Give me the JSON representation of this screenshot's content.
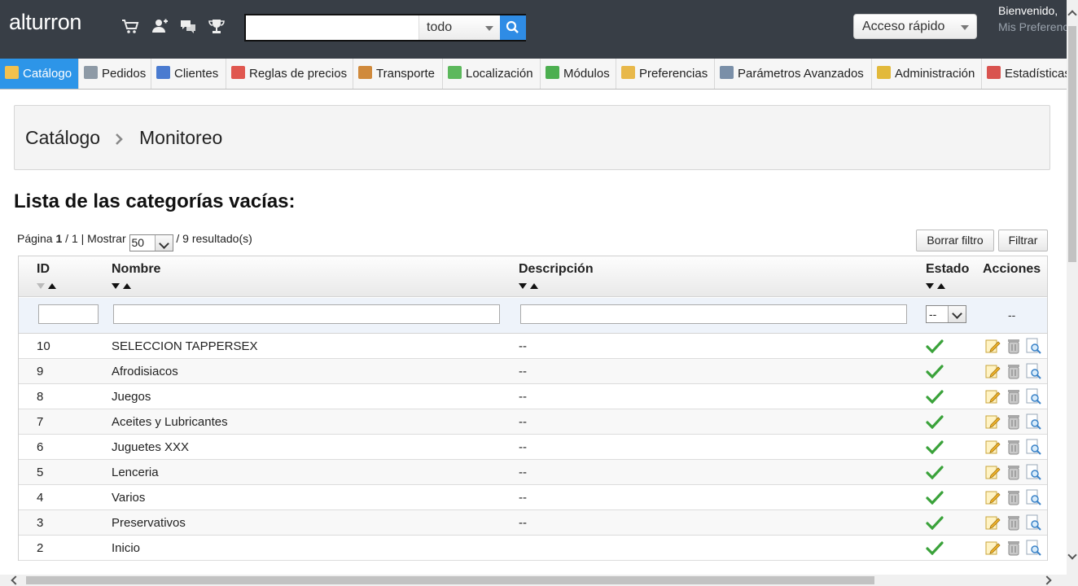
{
  "header": {
    "brand": "alturron",
    "icons": [
      "cart-icon",
      "customers-icon",
      "messages-icon",
      "trophy-icon"
    ],
    "search": {
      "value": "",
      "scope": "todo"
    },
    "quick_access": "Acceso rápido",
    "welcome": "Bienvenido,",
    "preferences_link": "Mis Preferencias"
  },
  "nav": {
    "tabs": [
      {
        "label": "Catálogo",
        "active": true,
        "color": "#f2c14e"
      },
      {
        "label": "Pedidos",
        "active": false,
        "color": "#8e9aa6"
      },
      {
        "label": "Clientes",
        "active": false,
        "color": "#4a7bd0"
      },
      {
        "label": "Reglas de precios",
        "active": false,
        "color": "#e0574f"
      },
      {
        "label": "Transporte",
        "active": false,
        "color": "#d08a3c"
      },
      {
        "label": "Localización",
        "active": false,
        "color": "#5cb85c"
      },
      {
        "label": "Módulos",
        "active": false,
        "color": "#4caf50"
      },
      {
        "label": "Preferencias",
        "active": false,
        "color": "#e8b84a"
      },
      {
        "label": "Parámetros Avanzados",
        "active": false,
        "color": "#7a8fa8"
      },
      {
        "label": "Administración",
        "active": false,
        "color": "#e2b93b"
      },
      {
        "label": "Estadísticas",
        "active": false,
        "color": "#d9534f"
      }
    ]
  },
  "breadcrumb": {
    "section": "Catálogo",
    "page": "Monitoreo"
  },
  "page_title": "Lista de las categorías vacías:",
  "pagination": {
    "page_label": "Página",
    "current_page": "1",
    "total_pages": "/ 1 | Mostrar",
    "per_page": "50",
    "results": "/ 9 resultado(s)"
  },
  "buttons": {
    "reset_filter": "Borrar filtro",
    "filter": "Filtrar"
  },
  "table": {
    "headers": {
      "id": "ID",
      "name": "Nombre",
      "description": "Descripción",
      "status": "Estado",
      "actions": "Acciones"
    },
    "filter": {
      "status_value": "--",
      "actions_placeholder": "--"
    },
    "rows": [
      {
        "id": "10",
        "name": "SELECCION TAPPERSEX",
        "description": "--"
      },
      {
        "id": "9",
        "name": "Afrodisiacos",
        "description": "--"
      },
      {
        "id": "8",
        "name": "Juegos",
        "description": "--"
      },
      {
        "id": "7",
        "name": "Aceites y Lubricantes",
        "description": "--"
      },
      {
        "id": "6",
        "name": "Juguetes XXX",
        "description": "--"
      },
      {
        "id": "5",
        "name": "Lenceria",
        "description": "--"
      },
      {
        "id": "4",
        "name": "Varios",
        "description": "--"
      },
      {
        "id": "3",
        "name": "Preservativos",
        "description": "--"
      },
      {
        "id": "2",
        "name": "Inicio",
        "description": ""
      }
    ]
  },
  "colors": {
    "header_bg": "#383e46",
    "accent": "#2d95e8",
    "check": "#3aa23a"
  }
}
